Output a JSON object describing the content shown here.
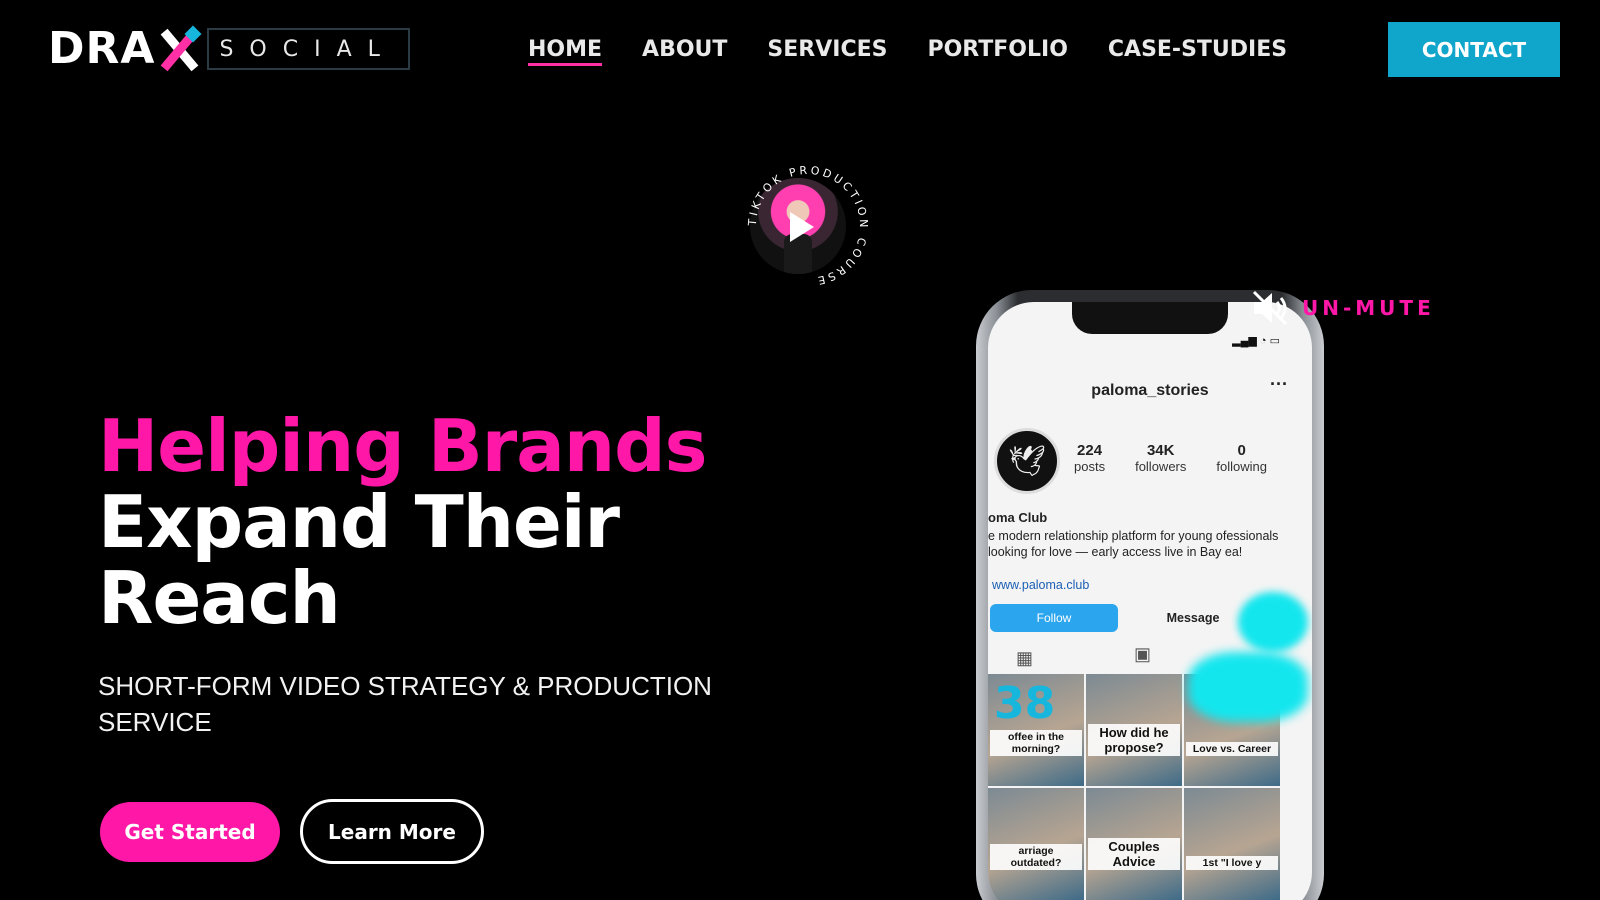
{
  "brand": {
    "logo_main": "DRA",
    "logo_sub": "SOCIAL",
    "accent_pink": "#ff17a8",
    "accent_cyan": "#10a6cc"
  },
  "nav": {
    "items": [
      {
        "label": "HOME",
        "active": true
      },
      {
        "label": "ABOUT",
        "active": false
      },
      {
        "label": "SERVICES",
        "active": false
      },
      {
        "label": "PORTFOLIO",
        "active": false
      },
      {
        "label": "CASE-STUDIES",
        "active": false
      }
    ],
    "contact_label": "CONTACT"
  },
  "hero": {
    "title_line1": "Helping Brands",
    "title_line2": "Expand Their",
    "title_line3": "Reach",
    "subtitle": "SHORT-FORM VIDEO STRATEGY & PRODUCTION SERVICE",
    "primary_cta": "Get Started",
    "secondary_cta": "Learn More"
  },
  "video_badge": {
    "ring_text": "TIKTOK PRODUCTION COURSE",
    "icon": "play-icon"
  },
  "unmute": {
    "label": "UN-MUTE",
    "icon": "speaker-muted-icon"
  },
  "phone": {
    "username": "paloma_stories",
    "stats": [
      {
        "num": "224",
        "label": "posts"
      },
      {
        "num": "34K",
        "label": "followers"
      },
      {
        "num": "0",
        "label": "following"
      }
    ],
    "name": "oma Club",
    "bio": "e modern relationship platform for young ofessionals looking for love — early access live in Bay ea!",
    "link": "www.paloma.club",
    "follow": "Follow",
    "message": "Message",
    "tiles": [
      {
        "caption": "offee in the morning?",
        "big": "38"
      },
      {
        "caption": "How did he propose?",
        "big": ""
      },
      {
        "caption": "Love vs. Career",
        "big": ""
      },
      {
        "caption": "arriage outdated?",
        "big": ""
      },
      {
        "caption": "Couples Advice",
        "big": ""
      },
      {
        "caption": "1st \"I love y",
        "big": ""
      }
    ]
  }
}
